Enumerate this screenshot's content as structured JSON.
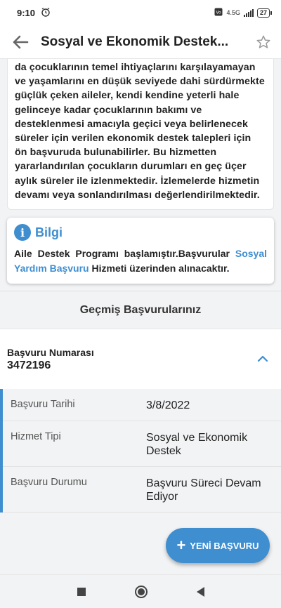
{
  "status_bar": {
    "time": "9:10",
    "network": "4.5G",
    "battery": "27"
  },
  "app_bar": {
    "title": "Sosyal ve Ekonomik Destek..."
  },
  "description": {
    "text": "da çocuklarının temel ihtiyaçlarını karşılayamayan ve yaşamlarını en düşük seviyede dahi sürdürmekte güçlük çeken aileler, kendi kendine yeterli hale gelinceye kadar çocuklarının bakımı ve desteklenmesi amacıyla geçici veya belirlenecek süreler için verilen ekonomik destek talepleri için ön başvuruda bulunabilirler. Bu hizmetten yararlandırılan çocukların durumları en geç üçer aylık süreler ile izlenmektedir. İzlemelerde hizmetin devamı veya sonlandırılması değerlendirilmektedir."
  },
  "info": {
    "icon": "info-icon",
    "title": "Bilgi",
    "text_before": "Aile Destek Programı başlamıştır.Başvurular ",
    "link": "Sosyal Yardım Başvuru",
    "text_after": " Hizmeti üzerinden alınacaktır."
  },
  "history": {
    "title": "Geçmiş Başvurularınız",
    "application_label": "Başvuru Numarası",
    "application_number": "3472196",
    "rows": [
      {
        "key": "Başvuru Tarihi",
        "value": "3/8/2022"
      },
      {
        "key": "Hizmet Tipi",
        "value": "Sosyal ve Ekonomik Destek"
      },
      {
        "key": "Başvuru Durumu",
        "value": "Başvuru Süreci Devam Ediyor"
      }
    ]
  },
  "fab": {
    "label": "YENİ BAŞVURU"
  },
  "colors": {
    "accent": "#3e8ed0"
  }
}
